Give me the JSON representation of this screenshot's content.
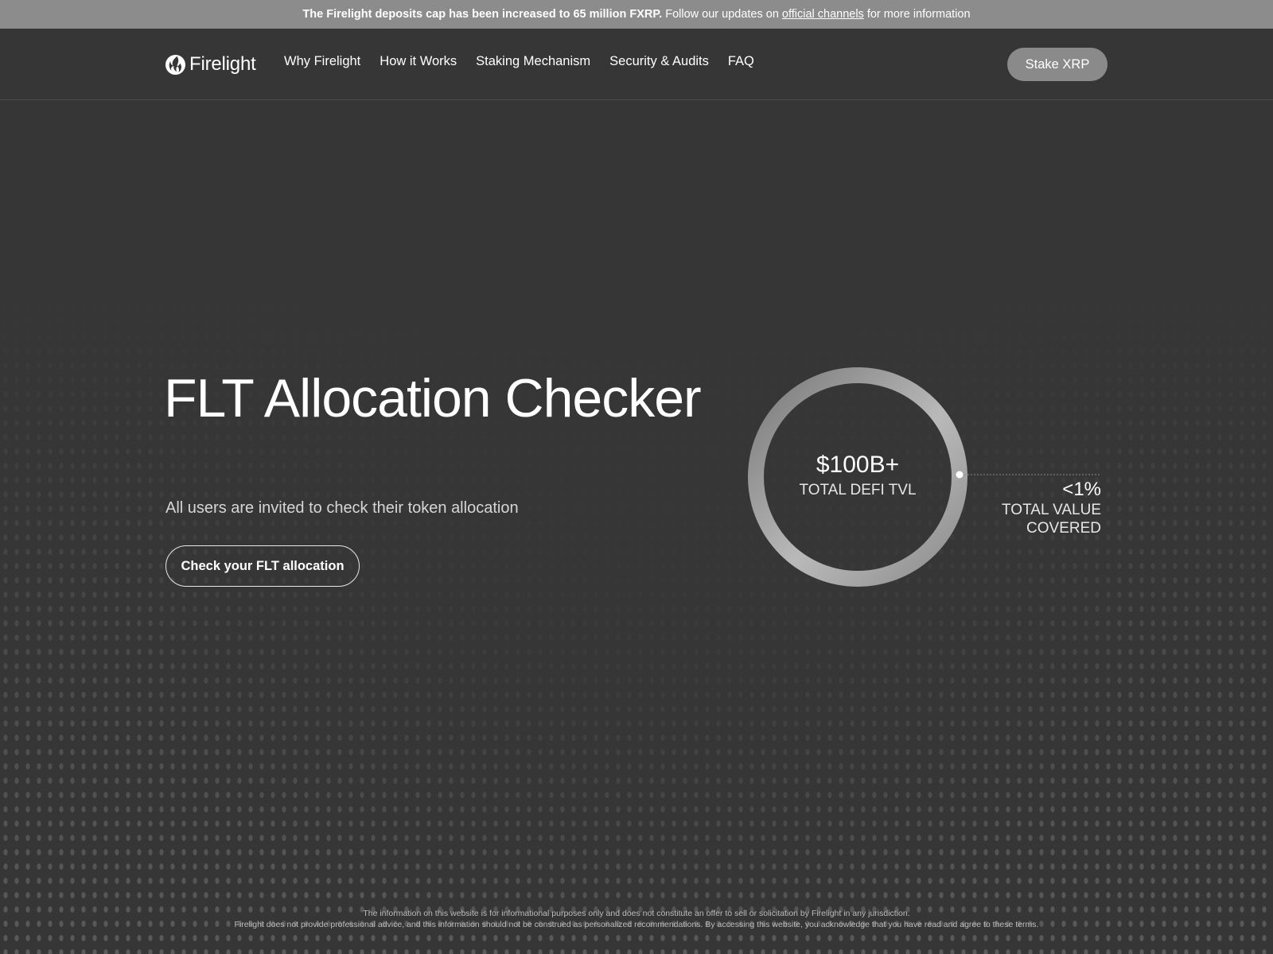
{
  "banner": {
    "strong_text": "The Firelight deposits cap has been increased to 65 million FXRP.",
    "pre_link": "Follow our updates on",
    "link_text": "official channels",
    "post_link": "for more information"
  },
  "header": {
    "logo_text": "Firelight",
    "nav": [
      "Why Firelight",
      "How it Works",
      "Staking Mechanism",
      "Security & Audits",
      "FAQ"
    ],
    "cta": "Stake XRP"
  },
  "hero": {
    "title": "FLT Allocation Checker",
    "subtitle": "All users are invited to check their token allocation",
    "button": "Check your FLT allocation"
  },
  "stats": {
    "ring_value": "$100B+",
    "ring_label": "TOTAL DEFI TVL",
    "side_value": "<1%",
    "side_label_line1": "TOTAL VALUE",
    "side_label_line2": "COVERED"
  },
  "disclaimer": {
    "line1": "The information on this website is for informational purposes only and does not constitute an offer to sell or solicitation by Firelight in any jurisdiction.",
    "line2": "Firelight does not provide professional advice, and this information should not be construed as personalized recommendations. By accessing this website, you acknowledge that you have read and agree to these terms."
  },
  "colors": {
    "background": "#363636",
    "banner": "#8c8c8c",
    "stake_button": "#8a8a8a",
    "text": "#ffffff"
  },
  "icons": {
    "logo": "flame-logo-icon"
  }
}
